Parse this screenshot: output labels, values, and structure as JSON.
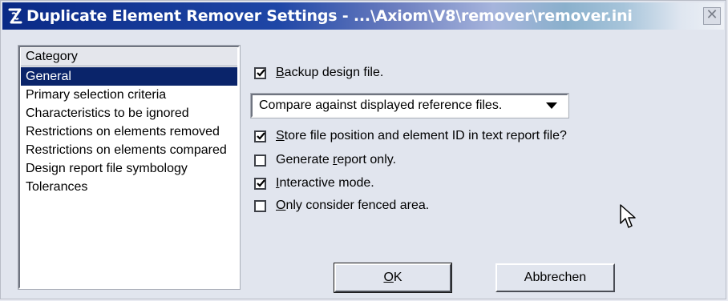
{
  "window": {
    "title": "Duplicate Element Remover Settings - ...\\Axiom\\V8\\remover\\remover.ini",
    "icon": "app-logo-icon",
    "close_label": "✕",
    "accent_color": "#0a2a86"
  },
  "category": {
    "header": "Category",
    "items": [
      "General",
      "Primary selection criteria",
      "Characteristics to be ignored",
      "Restrictions on elements removed",
      "Restrictions on elements compared",
      "Design report file symbology",
      "Tolerances"
    ],
    "selected_index": 0
  },
  "options": {
    "backup": {
      "mnemonic": "B",
      "rest": "ackup design file.",
      "checked": true
    },
    "compare_dropdown": {
      "selected": "Compare against displayed reference files."
    },
    "store_position": {
      "mnemonic": "S",
      "rest": "tore file position and element ID in text report file?",
      "checked": true
    },
    "generate_report": {
      "before": "Generate ",
      "mnemonic": "r",
      "rest": "eport only.",
      "checked": false
    },
    "interactive": {
      "mnemonic": "I",
      "rest": "nteractive mode.",
      "checked": true
    },
    "fenced_area": {
      "mnemonic": "O",
      "rest": "nly consider fenced area.",
      "checked": false
    }
  },
  "buttons": {
    "ok": {
      "mnemonic": "O",
      "rest": "K"
    },
    "cancel": "Abbrechen"
  }
}
